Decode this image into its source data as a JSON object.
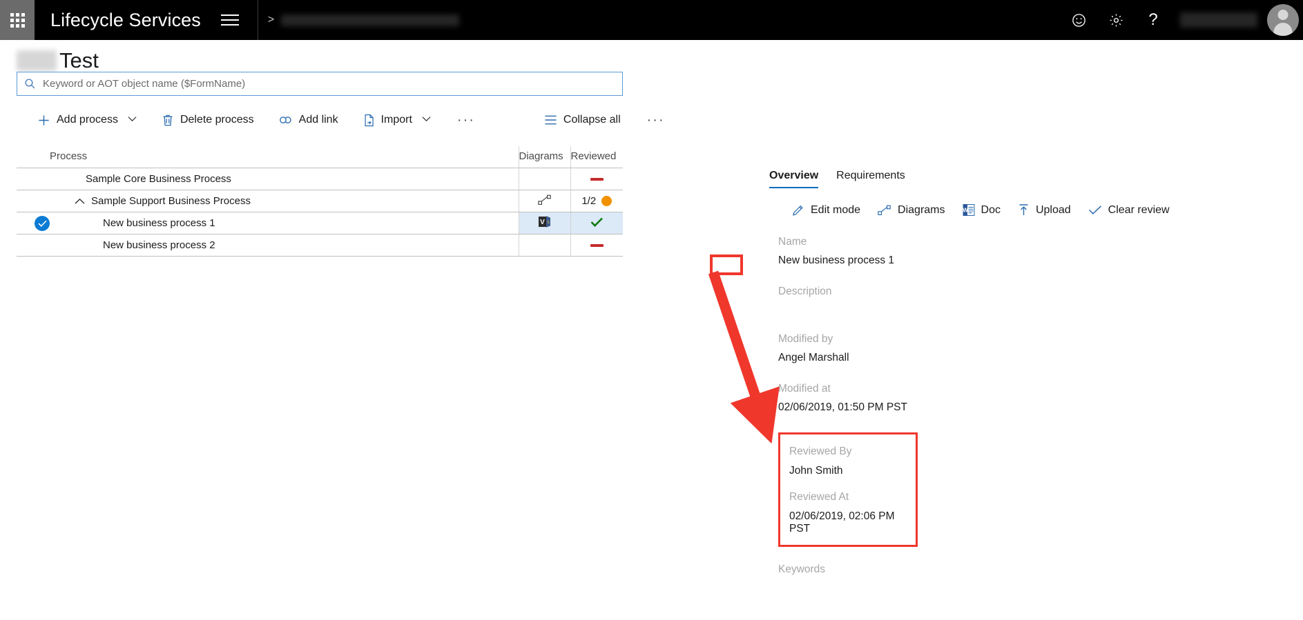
{
  "topbar": {
    "waffle_icon": "app-launcher-icon",
    "app_title": "Lifecycle Services",
    "hamburger_icon": "hamburger-menu-icon",
    "breadcrumb_separator": ">",
    "breadcrumb_redacted": "",
    "feedback_icon": "smiley-face-icon",
    "settings_icon": "gear-icon",
    "help_icon": "question-mark-icon",
    "user_name_redacted": "",
    "avatar_icon": "user-avatar-icon"
  },
  "heading": {
    "redacted_prefix": "",
    "title": "Test"
  },
  "search": {
    "icon": "search-icon",
    "value": "",
    "placeholder": "Keyword or AOT object name ($FormName)"
  },
  "toolbar": {
    "add_process": "Add process",
    "delete_process": "Delete process",
    "add_link": "Add link",
    "import": "Import",
    "overflow": "···",
    "collapse_all": "Collapse all",
    "overflow2": "···"
  },
  "table": {
    "columns": [
      "Process",
      "Diagrams",
      "Reviewed"
    ],
    "rows": [
      {
        "name": "Sample Core Business Process",
        "level": 0,
        "expandable": false,
        "selected": false,
        "diagram": "",
        "reviewed_kind": "none",
        "reviewed_text": ""
      },
      {
        "name": "Sample Support Business Process",
        "level": 0,
        "expandable": true,
        "expanded": true,
        "selected": false,
        "diagram": "diagram-shape-icon",
        "reviewed_kind": "partial",
        "reviewed_text": "1/2"
      },
      {
        "name": "New business process 1",
        "level": 1,
        "expandable": false,
        "selected": true,
        "diagram": "visio-file-icon",
        "reviewed_kind": "reviewed",
        "reviewed_text": ""
      },
      {
        "name": "New business process 2",
        "level": 1,
        "expandable": false,
        "selected": false,
        "diagram": "",
        "reviewed_kind": "none",
        "reviewed_text": ""
      }
    ]
  },
  "panel": {
    "tabs": [
      {
        "label": "Overview",
        "active": true
      },
      {
        "label": "Requirements",
        "active": false
      }
    ],
    "actions": [
      {
        "label": "Edit mode",
        "icon": "pencil-icon"
      },
      {
        "label": "Diagrams",
        "icon": "diagram-shape-icon"
      },
      {
        "label": "Doc",
        "icon": "word-doc-icon"
      },
      {
        "label": "Upload",
        "icon": "upload-arrow-icon"
      },
      {
        "label": "Clear review",
        "icon": "checkmark-icon"
      }
    ],
    "fields": {
      "name_label": "Name",
      "name_value": "New business process 1",
      "description_label": "Description",
      "description_value": "",
      "modified_by_label": "Modified by",
      "modified_by_value": "Angel Marshall",
      "modified_at_label": "Modified at",
      "modified_at_value": "02/06/2019, 01:50 PM PST",
      "reviewed_by_label": "Reviewed By",
      "reviewed_by_value": "John Smith",
      "reviewed_at_label": "Reviewed At",
      "reviewed_at_value": "02/06/2019, 02:06 PM PST",
      "keywords_label": "Keywords"
    }
  },
  "colors": {
    "accent_blue": "#0b6bbd",
    "icon_blue": "#2b6cb0",
    "annotation_red": "#f0372c",
    "review_green": "#107c10",
    "partial_orange": "#f29100",
    "dash_red": "#c42b2b",
    "selection_blue": "#0b7bd4",
    "row_highlight": "#dce9f7"
  }
}
